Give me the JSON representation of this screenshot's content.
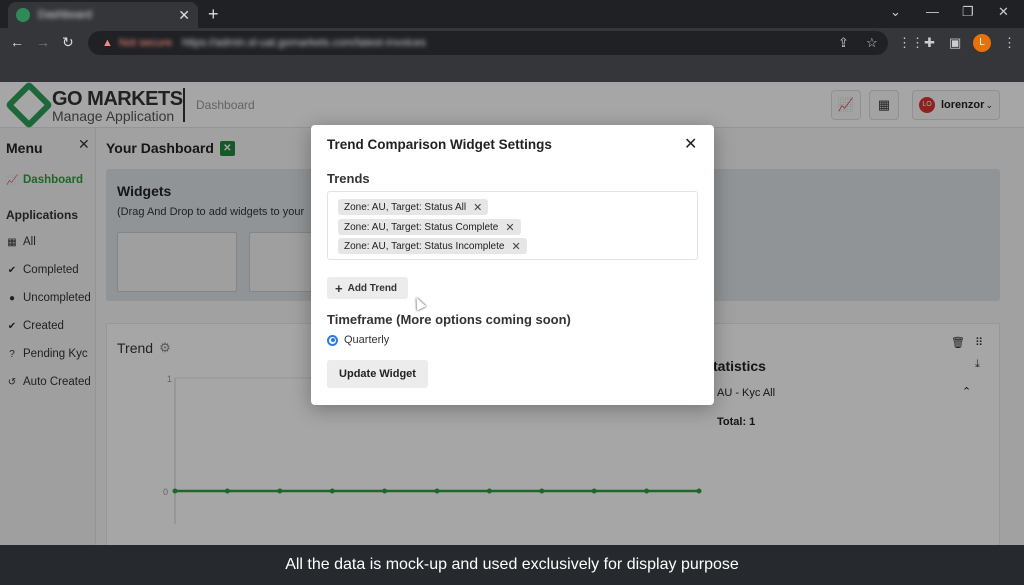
{
  "browser": {
    "tab_title": "Dashboard",
    "security_label": "Not secure",
    "url": "https://admin.sl-uat.gomarkets.com/latest-invoices",
    "profile_initial": "L"
  },
  "header": {
    "logo_primary": "GO MARKETS",
    "logo_secondary": "Manage Application",
    "breadcrumb": "Dashboard",
    "user_avatar": "LO",
    "username": "lorenzor"
  },
  "sidebar": {
    "title": "Menu",
    "dashboard_label": "Dashboard",
    "section_title": "Applications",
    "items": [
      {
        "label": "All",
        "icon": "table-icon"
      },
      {
        "label": "Completed",
        "icon": "check-icon"
      },
      {
        "label": "Uncompleted",
        "icon": "alert-icon"
      },
      {
        "label": "Created",
        "icon": "check-circle-icon"
      },
      {
        "label": "Pending Kyc",
        "icon": "help-icon"
      },
      {
        "label": "Auto Created",
        "icon": "history-icon"
      }
    ]
  },
  "main": {
    "title": "Your Dashboard",
    "widgets_title": "Widgets",
    "widgets_subtitle": "(Drag And Drop to add widgets to your",
    "trend_title": "Trend",
    "y_max": "1",
    "y_min": "0",
    "stats_title": "Statistics",
    "stats_visible": "tatistics",
    "stats_item": "AU - Kyc All",
    "stats_total": "Total: 1"
  },
  "modal": {
    "title": "Trend Comparison Widget Settings",
    "trends_label": "Trends",
    "chips": [
      "Zone: AU, Target: Status All",
      "Zone: AU, Target: Status Complete",
      "Zone: AU, Target: Status Incomplete"
    ],
    "add_trend_label": "Add Trend",
    "timeframe_label": "Timeframe (More options coming soon)",
    "timeframe_option": "Quarterly",
    "update_label": "Update Widget"
  },
  "caption": "All the data is mock-up and used exclusively for display purpose",
  "colors": {
    "brand_green": "#2e9e5b",
    "radio_blue": "#2c7be5",
    "trend_line": "#2e9e3c"
  }
}
